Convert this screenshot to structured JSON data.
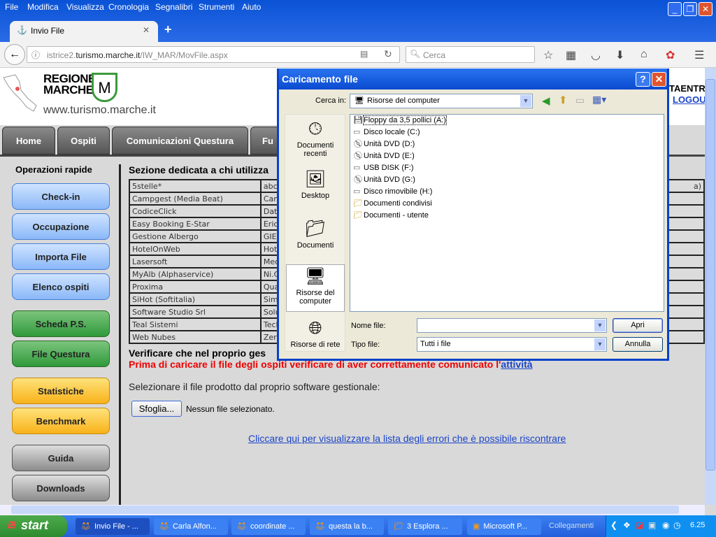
{
  "browser": {
    "menu": [
      "File",
      "Modifica",
      "Visualizza",
      "Cronologia",
      "Segnalibri",
      "Strumenti",
      "Aiuto"
    ],
    "tab_title": "Invio File",
    "url_prefix": "istrice2.",
    "url_domain": "turismo.marche.it",
    "url_path": "/IW_MAR/MovFile.aspx",
    "search_placeholder": "Cerca"
  },
  "site": {
    "logo_text_1": "REGIONE",
    "logo_text_2": "MARCHE",
    "site_url": "www.turismo.marche.it",
    "user_partial": "TAENTR",
    "logout": "LOGOU",
    "nav": [
      "Home",
      "Ospiti",
      "Comunicazioni Questura",
      "Fu"
    ],
    "sidebar_title": "Operazioni rapide",
    "sidebar": [
      "Check-in",
      "Occupazione",
      "Importa File",
      "Elenco ospiti",
      "Scheda P.S.",
      "File Questura",
      "Statistiche",
      "Benchmark",
      "Guida",
      "Downloads"
    ],
    "section_title": "Sezione dedicata a chi utilizza",
    "table": [
      [
        "5stelle*",
        "abc"
      ],
      [
        "Campgest (Media Beat)",
        "Cam"
      ],
      [
        "CodiceClick",
        "Dat"
      ],
      [
        "Easy Booking E-Star",
        "Eric"
      ],
      [
        "Gestione Albergo",
        "GIE"
      ],
      [
        "HotelOnWeb",
        "Hot"
      ],
      [
        "Lasersoft",
        "Med"
      ],
      [
        "MyAlb (Alphaservice)",
        "Ni.C"
      ],
      [
        "Proxima",
        "Qua"
      ],
      [
        "SiHot (Softitalia)",
        "Sim"
      ],
      [
        "Software Studio Srl",
        "Solu"
      ],
      [
        "Teal Sistemi",
        "Tech"
      ],
      [
        "Web Nubes",
        "Zer"
      ]
    ],
    "table_first_row_end": "a)",
    "verify_text": "Verificare che nel proprio ges",
    "warning_text": "Prima di caricare il file degli ospiti verificare di aver correttamente comunicato l'",
    "warning_link": "attività",
    "select_label": "Selezionare il file prodotto dal proprio software gestionale:",
    "browse_button": "Sfoglia...",
    "no_file": "Nessun file selezionato.",
    "errors_link": "Cliccare qui per visualizzare la lista degli errori che è possibile riscontrare"
  },
  "dialog": {
    "title": "Caricamento file",
    "look_in_label": "Cerca in:",
    "look_in_value": "Risorse del computer",
    "places": [
      "Documenti recenti",
      "Desktop",
      "Documenti",
      "Risorse del computer",
      "Risorse di rete"
    ],
    "files": [
      {
        "name": "Floppy da 3,5 pollici (A:)",
        "icon": "floppy"
      },
      {
        "name": "Disco locale (C:)",
        "icon": "drive"
      },
      {
        "name": "Unità DVD (D:)",
        "icon": "dvd"
      },
      {
        "name": "Unità DVD (E:)",
        "icon": "dvd"
      },
      {
        "name": "USB DISK (F:)",
        "icon": "drive"
      },
      {
        "name": "Unità DVD (G:)",
        "icon": "dvd"
      },
      {
        "name": "Disco rimovibile (H:)",
        "icon": "drive"
      },
      {
        "name": "Documenti condivisi",
        "icon": "folder"
      },
      {
        "name": "Documenti - utente",
        "icon": "folder"
      }
    ],
    "filename_label": "Nome file:",
    "filename_value": "",
    "filetype_label": "Tipo file:",
    "filetype_value": "Tutti i file",
    "open_button": "Apri",
    "cancel_button": "Annulla"
  },
  "taskbar": {
    "start": "start",
    "items": [
      "Invio File - ...",
      "Carla Alfon...",
      "coordinate ...",
      "questa la b...",
      "3 Esplora ...",
      "Microsoft P..."
    ],
    "links": "Collegamenti",
    "clock": "6.25"
  }
}
